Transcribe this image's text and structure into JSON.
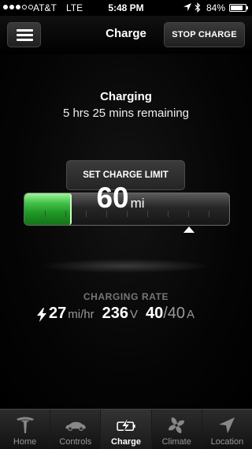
{
  "status_bar": {
    "carrier": "AT&T",
    "network": "LTE",
    "time": "5:48 PM",
    "battery_percent": "84%",
    "battery_level": 0.84
  },
  "nav": {
    "title": "Charge",
    "stop_button": "STOP CHARGE"
  },
  "charge": {
    "status_title": "Charging",
    "time_remaining": "5 hrs 25 mins remaining",
    "set_limit_button": "SET CHARGE LIMIT",
    "range_value": "60",
    "range_unit": "mi",
    "fill_fraction": 0.23,
    "limit_fraction": 0.8,
    "gauge_color": "#2fa836"
  },
  "charging_rate": {
    "label": "CHARGING RATE",
    "speed_value": "27",
    "speed_unit": "mi/hr",
    "voltage_value": "236",
    "voltage_unit": "V",
    "current_value": "40",
    "current_max": "/40",
    "current_unit": "A"
  },
  "tabs": [
    {
      "label": "Home",
      "icon": "tesla-logo-icon",
      "active": false
    },
    {
      "label": "Controls",
      "icon": "car-icon",
      "active": false
    },
    {
      "label": "Charge",
      "icon": "charge-battery-icon",
      "active": true
    },
    {
      "label": "Climate",
      "icon": "fan-icon",
      "active": false
    },
    {
      "label": "Location",
      "icon": "location-arrow-icon",
      "active": false
    }
  ]
}
